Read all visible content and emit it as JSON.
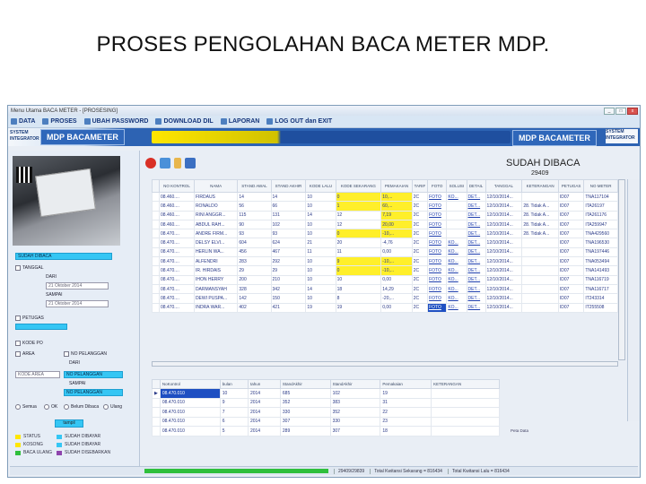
{
  "slide": {
    "title": "PROSES PENGOLAHAN BACA METER MDP."
  },
  "window": {
    "title": "Menu Utama BACA METER - [PROSESING]",
    "btn_min": "_",
    "btn_max": "□",
    "btn_close": "x"
  },
  "menu": {
    "items": [
      "DATA",
      "PROSES",
      "UBAH PASSWORD",
      "DOWNLOAD DIL",
      "LAPORAN",
      "LOG OUT dan EXIT"
    ]
  },
  "banner": {
    "logo_text_1": "SYSTEM",
    "logo_text_2": "INTEGRATOR",
    "app_name": "MDP BACAMETER"
  },
  "left": {
    "search_value": "SUDAH DIBACA",
    "chk_tanggal": "TANGGAL",
    "lbl_dari": "DARI",
    "date_from": "21 Oktober 2014",
    "lbl_sampai": "SAMPAI",
    "date_to": "21 Oktober 2014",
    "chk_petugas": "PETUGAS",
    "chk_kode": "KODE PO",
    "chk_area": "AREA",
    "chk_nopel": "NO PELANGGAN",
    "lbl_dari2": "DARI",
    "nopel_from": "NO PELANGGAN",
    "kode_area_placeholder": "KODE AREA",
    "lbl_sampai2": "SAMPAI",
    "nopel_to": "NO PELANGGAN",
    "radio_semua": "Semua",
    "radio_ok": "OK",
    "radio_belum": "Belum Dibaca",
    "radio_ulang": "Ulang",
    "btn_tampil": "tampil",
    "legends": [
      {
        "label": "STATUS",
        "color": "#ffe600"
      },
      {
        "label": "SUDAH DIBAYAR",
        "color": "#35c6f4"
      },
      {
        "label": "KOSONG",
        "color": "#ffe600"
      },
      {
        "label": "SUDAH DIBAYAR",
        "color": "#35c6f4"
      },
      {
        "label": "BACA ULANG",
        "color": "#2fbf3c"
      },
      {
        "label": "SUDAH DISEBARKAN",
        "color": "#8e44ad"
      }
    ]
  },
  "status": {
    "title": "SUDAH DIBACA",
    "count": "29409"
  },
  "grid1": {
    "headers": [
      "NO KONTROL",
      "NAMA",
      "STAND AWAL",
      "STAND AKHIR",
      "KODE LALU",
      "KODE SEKARANG",
      "PEMAKAIAN",
      "TARIF",
      "FOTO",
      "SOLUSI",
      "DETAIL",
      "TANGGAL",
      "KETERANGAN",
      "PETUGAS",
      "NO METER"
    ],
    "rows": [
      [
        "08.460....",
        "FIRDAUS",
        "14",
        "14",
        "10",
        "0",
        "10,...",
        "2C",
        "FOTO",
        "KO...",
        "DET...",
        "12/10/2014...",
        "",
        "ID07",
        "TNA117104"
      ],
      [
        "08.460....",
        "RONALDO",
        "56",
        "66",
        "10",
        "1",
        "60,...",
        "2C",
        "FOTO",
        "",
        "DET...",
        "12/10/2014...",
        "28. Tidak A...",
        "ID07",
        "ITA26197"
      ],
      [
        "08.460....",
        "RINI ANGGR...",
        "115",
        "131",
        "14",
        "12",
        "7,19",
        "2C",
        "FOTO",
        "",
        "DET...",
        "12/10/2014...",
        "28. Tidak A...",
        "ID07",
        "ITA261176"
      ],
      [
        "08.460....",
        "ABDUL RAH...",
        "90",
        "102",
        "10",
        "12",
        "20,00",
        "2C",
        "FOTO",
        "",
        "DET...",
        "12/10/2014...",
        "28. Tidak A...",
        "ID07",
        "ITA259947"
      ],
      [
        "08.470....",
        "ANDRE FIRM...",
        "93",
        "93",
        "10",
        "0",
        "-10,...",
        "2C",
        "FOTO",
        "",
        "DET...",
        "12/10/2014...",
        "28. Tidak A...",
        "ID07",
        "TNA429560"
      ],
      [
        "08.470....",
        "DELSY ELVI...",
        "604",
        "624",
        "21",
        "20",
        "-4,76",
        "2C",
        "FOTO",
        "KO...",
        "DET...",
        "12/10/2014...",
        "",
        "ID07",
        "TNA196530"
      ],
      [
        "08.470....",
        "HERLIN WA...",
        "456",
        "467",
        "11",
        "11",
        "0,00",
        "2C",
        "FOTO",
        "KO...",
        "DET...",
        "12/10/2014...",
        "",
        "ID07",
        "TNA197446"
      ],
      [
        "08.470....",
        "ALFENDRI",
        "283",
        "292",
        "10",
        "9",
        "-10,...",
        "2C",
        "FOTO",
        "KO...",
        "DET...",
        "12/10/2014...",
        "",
        "ID07",
        "TNA053494"
      ],
      [
        "08.470....",
        "IR. HIRDAIS",
        "29",
        "29",
        "10",
        "0",
        "-10,...",
        "2C",
        "FOTO",
        "KO...",
        "DET...",
        "12/10/2014...",
        "",
        "ID07",
        "TNA141493"
      ],
      [
        "08.470....",
        "IHON HERRY",
        "200",
        "210",
        "10",
        "10",
        "0,00",
        "2C",
        "FOTO",
        "KO...",
        "DET...",
        "12/10/2014...",
        "",
        "ID07",
        "TNA116719"
      ],
      [
        "08.470....",
        "DARMANSYAH",
        "328",
        "342",
        "14",
        "18",
        "14,29",
        "2C",
        "FOTO",
        "KO...",
        "DET...",
        "12/10/2014...",
        "",
        "ID07",
        "TNA116717"
      ],
      [
        "08.470....",
        "DEWI PUSPA...",
        "142",
        "150",
        "10",
        "8",
        "-20,...",
        "2C",
        "FOTO",
        "KO...",
        "DET...",
        "12/10/2014...",
        "",
        "ID07",
        "IT243314"
      ],
      [
        "08.470....",
        "INDRA WAR...",
        "402",
        "421",
        "19",
        "19",
        "0,00",
        "2C",
        "FOTO",
        "KO...",
        "DET...",
        "12/10/2014...",
        "",
        "ID07",
        "IT255508"
      ]
    ]
  },
  "grid2": {
    "headers": [
      "NoKontrol",
      "bulan",
      "tahun",
      "StandAkhir",
      "StandAkhir",
      "Pemakaian",
      "KETERANGAN"
    ],
    "rows": [
      [
        "08.470.010",
        "10",
        "2014",
        "685",
        "102",
        "19",
        ""
      ],
      [
        "08.470.010",
        "9",
        "2014",
        "352",
        "383",
        "31",
        ""
      ],
      [
        "08.470.010",
        "7",
        "2014",
        "330",
        "352",
        "22",
        ""
      ],
      [
        "08.470.010",
        "6",
        "2014",
        "307",
        "330",
        "23",
        ""
      ],
      [
        "08.470.010",
        "5",
        "2014",
        "289",
        "307",
        "18",
        ""
      ]
    ]
  },
  "petadata": "Peta Data",
  "statusbar": {
    "seg1": "29409/29839",
    "seg2": "Total Kwitansi Sekarang = 816434",
    "seg3": "Total Kwitansi Lalu = 816434"
  }
}
